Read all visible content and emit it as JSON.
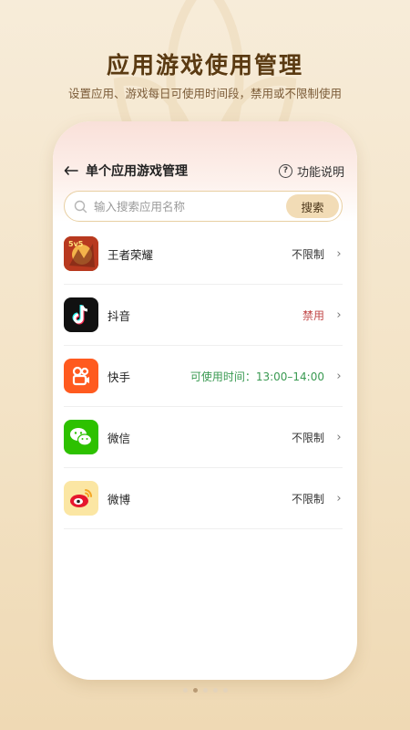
{
  "hero": {
    "title": "应用游戏使用管理",
    "subtitle": "设置应用、游戏每日可使用时间段，禁用或不限制使用"
  },
  "header": {
    "back_icon": "back-arrow-icon",
    "title": "单个应用游戏管理",
    "help_icon": "help-circle-icon",
    "help_label": "功能说明"
  },
  "search": {
    "placeholder": "输入搜索应用名称",
    "value": "",
    "button_label": "搜索"
  },
  "apps": [
    {
      "name": "王者荣耀",
      "status": "不限制",
      "status_color": "#333333",
      "icon": "honor-of-kings-icon"
    },
    {
      "name": "抖音",
      "status": "禁用",
      "status_color": "#c24a4a",
      "icon": "douyin-icon"
    },
    {
      "name": "快手",
      "status": "可使用时间：13:00–14:00",
      "status_color": "#3a9a52",
      "icon": "kuaishou-icon"
    },
    {
      "name": "微信",
      "status": "不限制",
      "status_color": "#333333",
      "icon": "wechat-icon"
    },
    {
      "name": "微博",
      "status": "不限制",
      "status_color": "#333333",
      "icon": "weibo-icon"
    }
  ],
  "pager": {
    "count": 5,
    "active": 2
  },
  "colors": {
    "background": "#f3e3c6",
    "title": "#5a3a12",
    "accent": "#f2dcb6",
    "banned": "#c24a4a",
    "allowed": "#3a9a52"
  }
}
